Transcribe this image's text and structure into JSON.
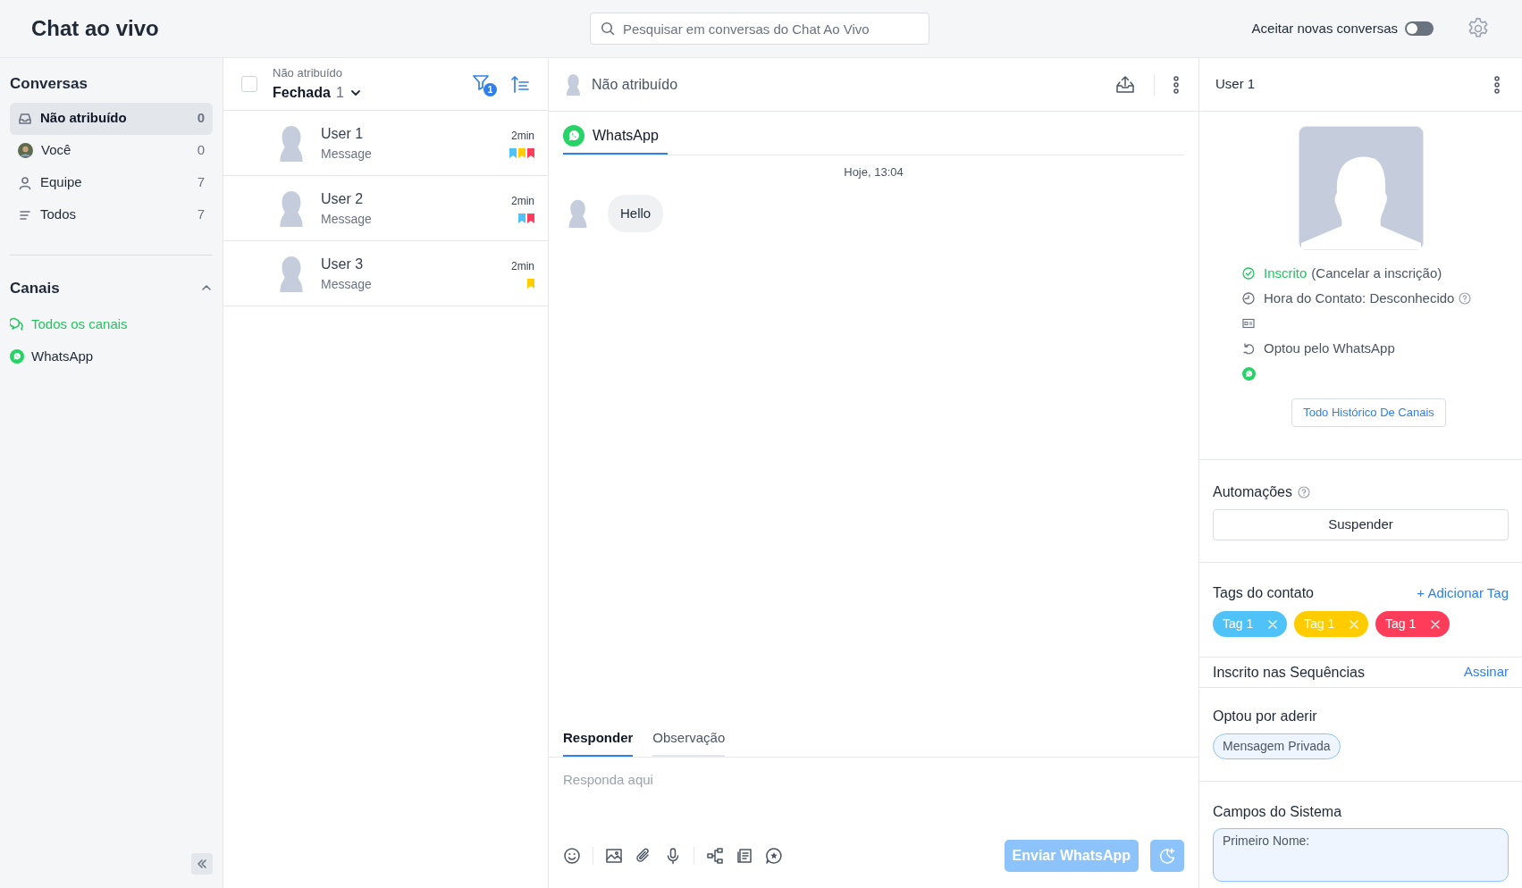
{
  "header": {
    "title": "Chat ao vivo",
    "search": {
      "placeholder": "Pesquisar em conversas do Chat Ao Vivo"
    },
    "accept_toggle": {
      "label": "Aceitar novas conversas",
      "on": false
    }
  },
  "sidebar": {
    "conversations_title": "Conversas",
    "items": [
      {
        "label": "Não atribuído",
        "count": "0",
        "selected": true,
        "kind": "inbox"
      },
      {
        "label": "Você",
        "count": "0",
        "selected": false,
        "kind": "me"
      },
      {
        "label": "Equipe",
        "count": "7",
        "selected": false,
        "kind": "team"
      },
      {
        "label": "Todos",
        "count": "7",
        "selected": false,
        "kind": "all"
      }
    ],
    "channels_title": "Canais",
    "channels_expanded": true,
    "channels": [
      {
        "label": "Todos os canais",
        "selected": true,
        "kind": "all"
      },
      {
        "label": "WhatsApp",
        "selected": false,
        "kind": "whatsapp"
      }
    ]
  },
  "list": {
    "checked": false,
    "subtitle": "Não atribuído",
    "status": "Fechada",
    "status_count": "1",
    "filter_badge": "1",
    "conversations": [
      {
        "name": "User 1",
        "preview": "Message",
        "time": "2min",
        "tags": [
          {
            "color": "#4fc3f7"
          },
          {
            "color": "#ffcc00"
          },
          {
            "color": "#ff3d5a"
          }
        ]
      },
      {
        "name": "User 2",
        "preview": "Message",
        "time": "2min",
        "tags": [
          {
            "color": "#4fc3f7"
          },
          {
            "color": "#ff3d5a"
          }
        ]
      },
      {
        "name": "User 3",
        "preview": "Message",
        "time": "2min",
        "tags": [
          {
            "color": "#ffcc00"
          }
        ]
      }
    ]
  },
  "chat": {
    "assignee": "Não atribuído",
    "channel_tabs": [
      {
        "label": "WhatsApp",
        "selected": true
      }
    ],
    "date": "Hoje, 13:04",
    "messages": [
      {
        "text": "Hello"
      }
    ],
    "composer_tabs": [
      {
        "label": "Responder",
        "selected": true
      },
      {
        "label": "Observação",
        "selected": false
      }
    ],
    "composer": {
      "placeholder": "Responda aqui"
    },
    "send_button": {
      "label": "Enviar WhatsApp",
      "disabled": true
    }
  },
  "contact": {
    "name": "User 1",
    "subscribed_label": "Inscrito",
    "unsubscribe": "(Cancelar a inscrição)",
    "contact_time": "Hora do Contato: Desconhecido",
    "opted": "Optou pelo WhatsApp",
    "history_button": "Todo Histórico De Canais",
    "automations_title": "Automações",
    "suspend_button": "Suspender",
    "tags_title": "Tags do contato",
    "add_tag": "+ Adicionar Tag",
    "tags": [
      {
        "label": "Tag 1",
        "color": "#4fc3f7"
      },
      {
        "label": "Tag 1",
        "color": "#ffcc00"
      },
      {
        "label": "Tag 1",
        "color": "#ff3d5a"
      }
    ],
    "sequences_title": "Inscrito nas Sequências",
    "subscribe_link": "Assinar",
    "optin_title": "Optou por aderir",
    "optin_chips": [
      "Mensagem Privada"
    ],
    "system_fields_title": "Campos do Sistema",
    "fields": [
      {
        "placeholder": "Primeiro Nome:"
      }
    ]
  }
}
